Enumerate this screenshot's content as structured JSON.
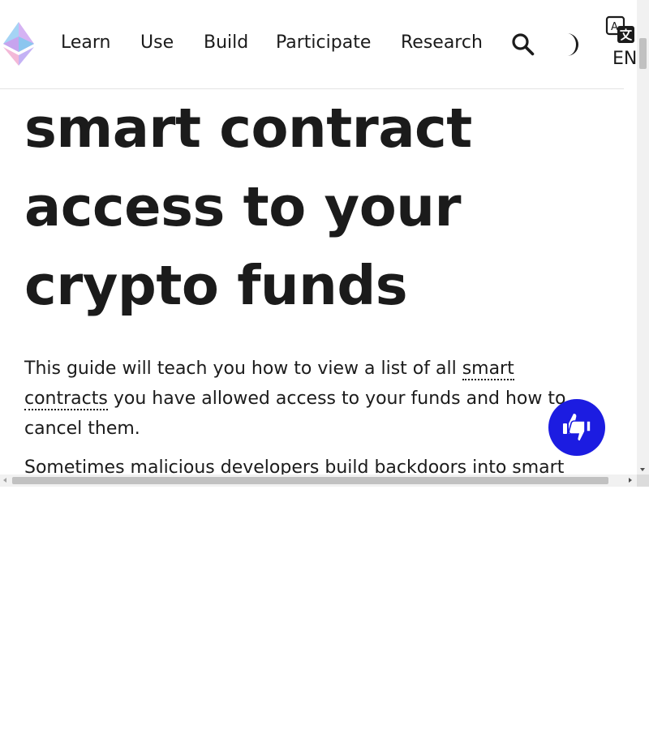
{
  "nav": {
    "items": [
      {
        "label": "Learn"
      },
      {
        "label": "Use"
      },
      {
        "label": "Build"
      },
      {
        "label": "Participate"
      },
      {
        "label": "Research"
      }
    ],
    "language": "EN",
    "icons": [
      "ethereum-logo",
      "search-icon",
      "theme-toggle-icon",
      "translate-icon"
    ]
  },
  "article": {
    "title_lines": [
      "smart contract",
      "access to your",
      "crypto funds"
    ],
    "para1_before": "This guide will teach you how to view a list of all ",
    "para1_link": "smart contracts",
    "para1_after": " you have allowed access to your funds and how to cancel them.",
    "para2": "Sometimes malicious developers build backdoors into smart"
  },
  "feedback": {
    "icon": "thumbs-up-down-icon"
  },
  "colors": {
    "accent": "#1c1ce1",
    "text": "#1b1b1b",
    "divider": "#e3e3e3"
  }
}
